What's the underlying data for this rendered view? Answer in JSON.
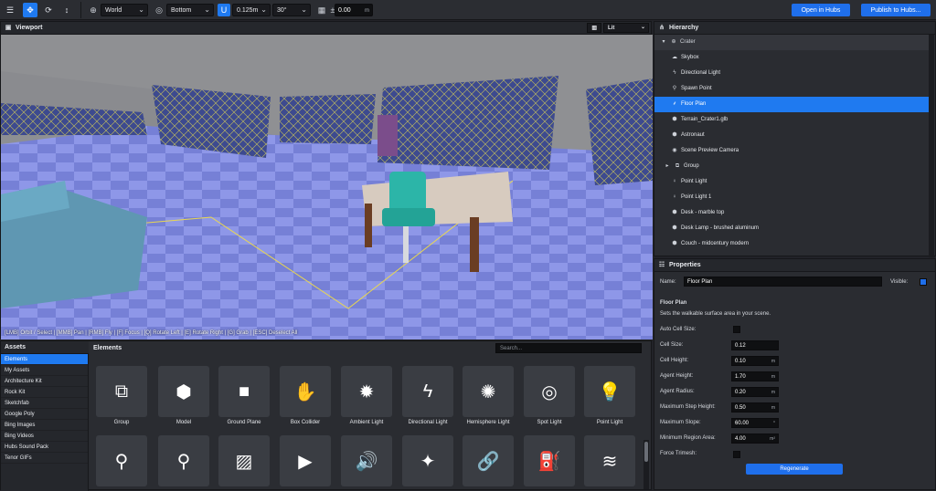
{
  "toolbar": {
    "space": "World",
    "pivot": "Bottom",
    "snap_translate": "0.125m",
    "snap_rotate": "30°",
    "grid_height": "0.00",
    "grid_unit": "m",
    "open_in_hubs": "Open in Hubs",
    "publish": "Publish to Hubs..."
  },
  "viewport": {
    "title": "Viewport",
    "render_mode": "Lit",
    "hint": "[LMB] Orbit / Select | [MMB] Pan | [RMB] Fly | [F] Focus | [Q] Rotate Left | [E] Rotate Right | [G] Grab | [ESC] Deselect All"
  },
  "assets": {
    "title": "Assets",
    "categories": [
      "Elements",
      "My Assets",
      "Architecture Kit",
      "Rock Kit",
      "Sketchfab",
      "Google Poly",
      "Bing Images",
      "Bing Videos",
      "Hubs Sound Pack",
      "Tenor GIFs"
    ],
    "elements_title": "Elements",
    "search_placeholder": "Search...",
    "elements": [
      {
        "label": "Group",
        "icon": "cubes-icon"
      },
      {
        "label": "Model",
        "icon": "cube-icon"
      },
      {
        "label": "Ground Plane",
        "icon": "square-icon"
      },
      {
        "label": "Box Collider",
        "icon": "hand-icon"
      },
      {
        "label": "Ambient Light",
        "icon": "sun-icon"
      },
      {
        "label": "Directional Light",
        "icon": "bolt-icon"
      },
      {
        "label": "Hemisphere Light",
        "icon": "certificate-icon"
      },
      {
        "label": "Spot Light",
        "icon": "target-icon"
      },
      {
        "label": "Point Light",
        "icon": "lightbulb-icon"
      },
      {
        "label": "",
        "icon": "spawn-point-icon"
      },
      {
        "label": "",
        "icon": "waypoint-icon"
      },
      {
        "label": "",
        "icon": "image-icon"
      },
      {
        "label": "",
        "icon": "video-icon"
      },
      {
        "label": "",
        "icon": "audio-icon"
      },
      {
        "label": "",
        "icon": "magic-wand-icon"
      },
      {
        "label": "",
        "icon": "link-icon"
      },
      {
        "label": "",
        "icon": "spray-can-icon"
      },
      {
        "label": "",
        "icon": "water-icon"
      }
    ]
  },
  "hierarchy": {
    "title": "Hierarchy",
    "items": [
      {
        "label": "Crater",
        "icon": "globe-icon"
      },
      {
        "label": "Skybox",
        "icon": "cloud-icon"
      },
      {
        "label": "Directional Light",
        "icon": "bolt-icon"
      },
      {
        "label": "Spawn Point",
        "icon": "street-view-icon"
      },
      {
        "label": "Floor Plan",
        "icon": "shoe-prints-icon"
      },
      {
        "label": "Terrain_Crater1.glb",
        "icon": "cube-icon"
      },
      {
        "label": "Astronaut",
        "icon": "cube-icon"
      },
      {
        "label": "Scene Preview Camera",
        "icon": "camera-icon"
      },
      {
        "label": "Group",
        "icon": "cubes-icon"
      },
      {
        "label": "Point Light",
        "icon": "lightbulb-icon"
      },
      {
        "label": "Point Light 1",
        "icon": "lightbulb-icon"
      },
      {
        "label": "Desk - marble top",
        "icon": "cube-icon"
      },
      {
        "label": "Desk Lamp - brushed aluminum",
        "icon": "cube-icon"
      },
      {
        "label": "Couch - midcentury modern",
        "icon": "cube-icon"
      }
    ]
  },
  "properties": {
    "title": "Properties",
    "name_label": "Name:",
    "name_value": "Floor Plan",
    "visible_label": "Visible:",
    "section_title": "Floor Plan",
    "section_desc": "Sets the walkable surface area in your scene.",
    "fields": [
      {
        "label": "Auto Cell Size:",
        "type": "checkbox",
        "value": ""
      },
      {
        "label": "Cell Size:",
        "type": "input",
        "value": "0.12",
        "unit": ""
      },
      {
        "label": "Cell Height:",
        "type": "input",
        "value": "0.10",
        "unit": "m"
      },
      {
        "label": "Agent Height:",
        "type": "input",
        "value": "1.70",
        "unit": "m"
      },
      {
        "label": "Agent Radius:",
        "type": "input",
        "value": "0.20",
        "unit": "m"
      },
      {
        "label": "Maximum Step Height:",
        "type": "input",
        "value": "0.50",
        "unit": "m"
      },
      {
        "label": "Maximum Slope:",
        "type": "input",
        "value": "60.00",
        "unit": "°"
      },
      {
        "label": "Minimum Region Area:",
        "type": "input",
        "value": "4.00",
        "unit": "m²"
      },
      {
        "label": "Force Trimesh:",
        "type": "checkbox",
        "value": ""
      }
    ],
    "regenerate": "Regenerate"
  }
}
